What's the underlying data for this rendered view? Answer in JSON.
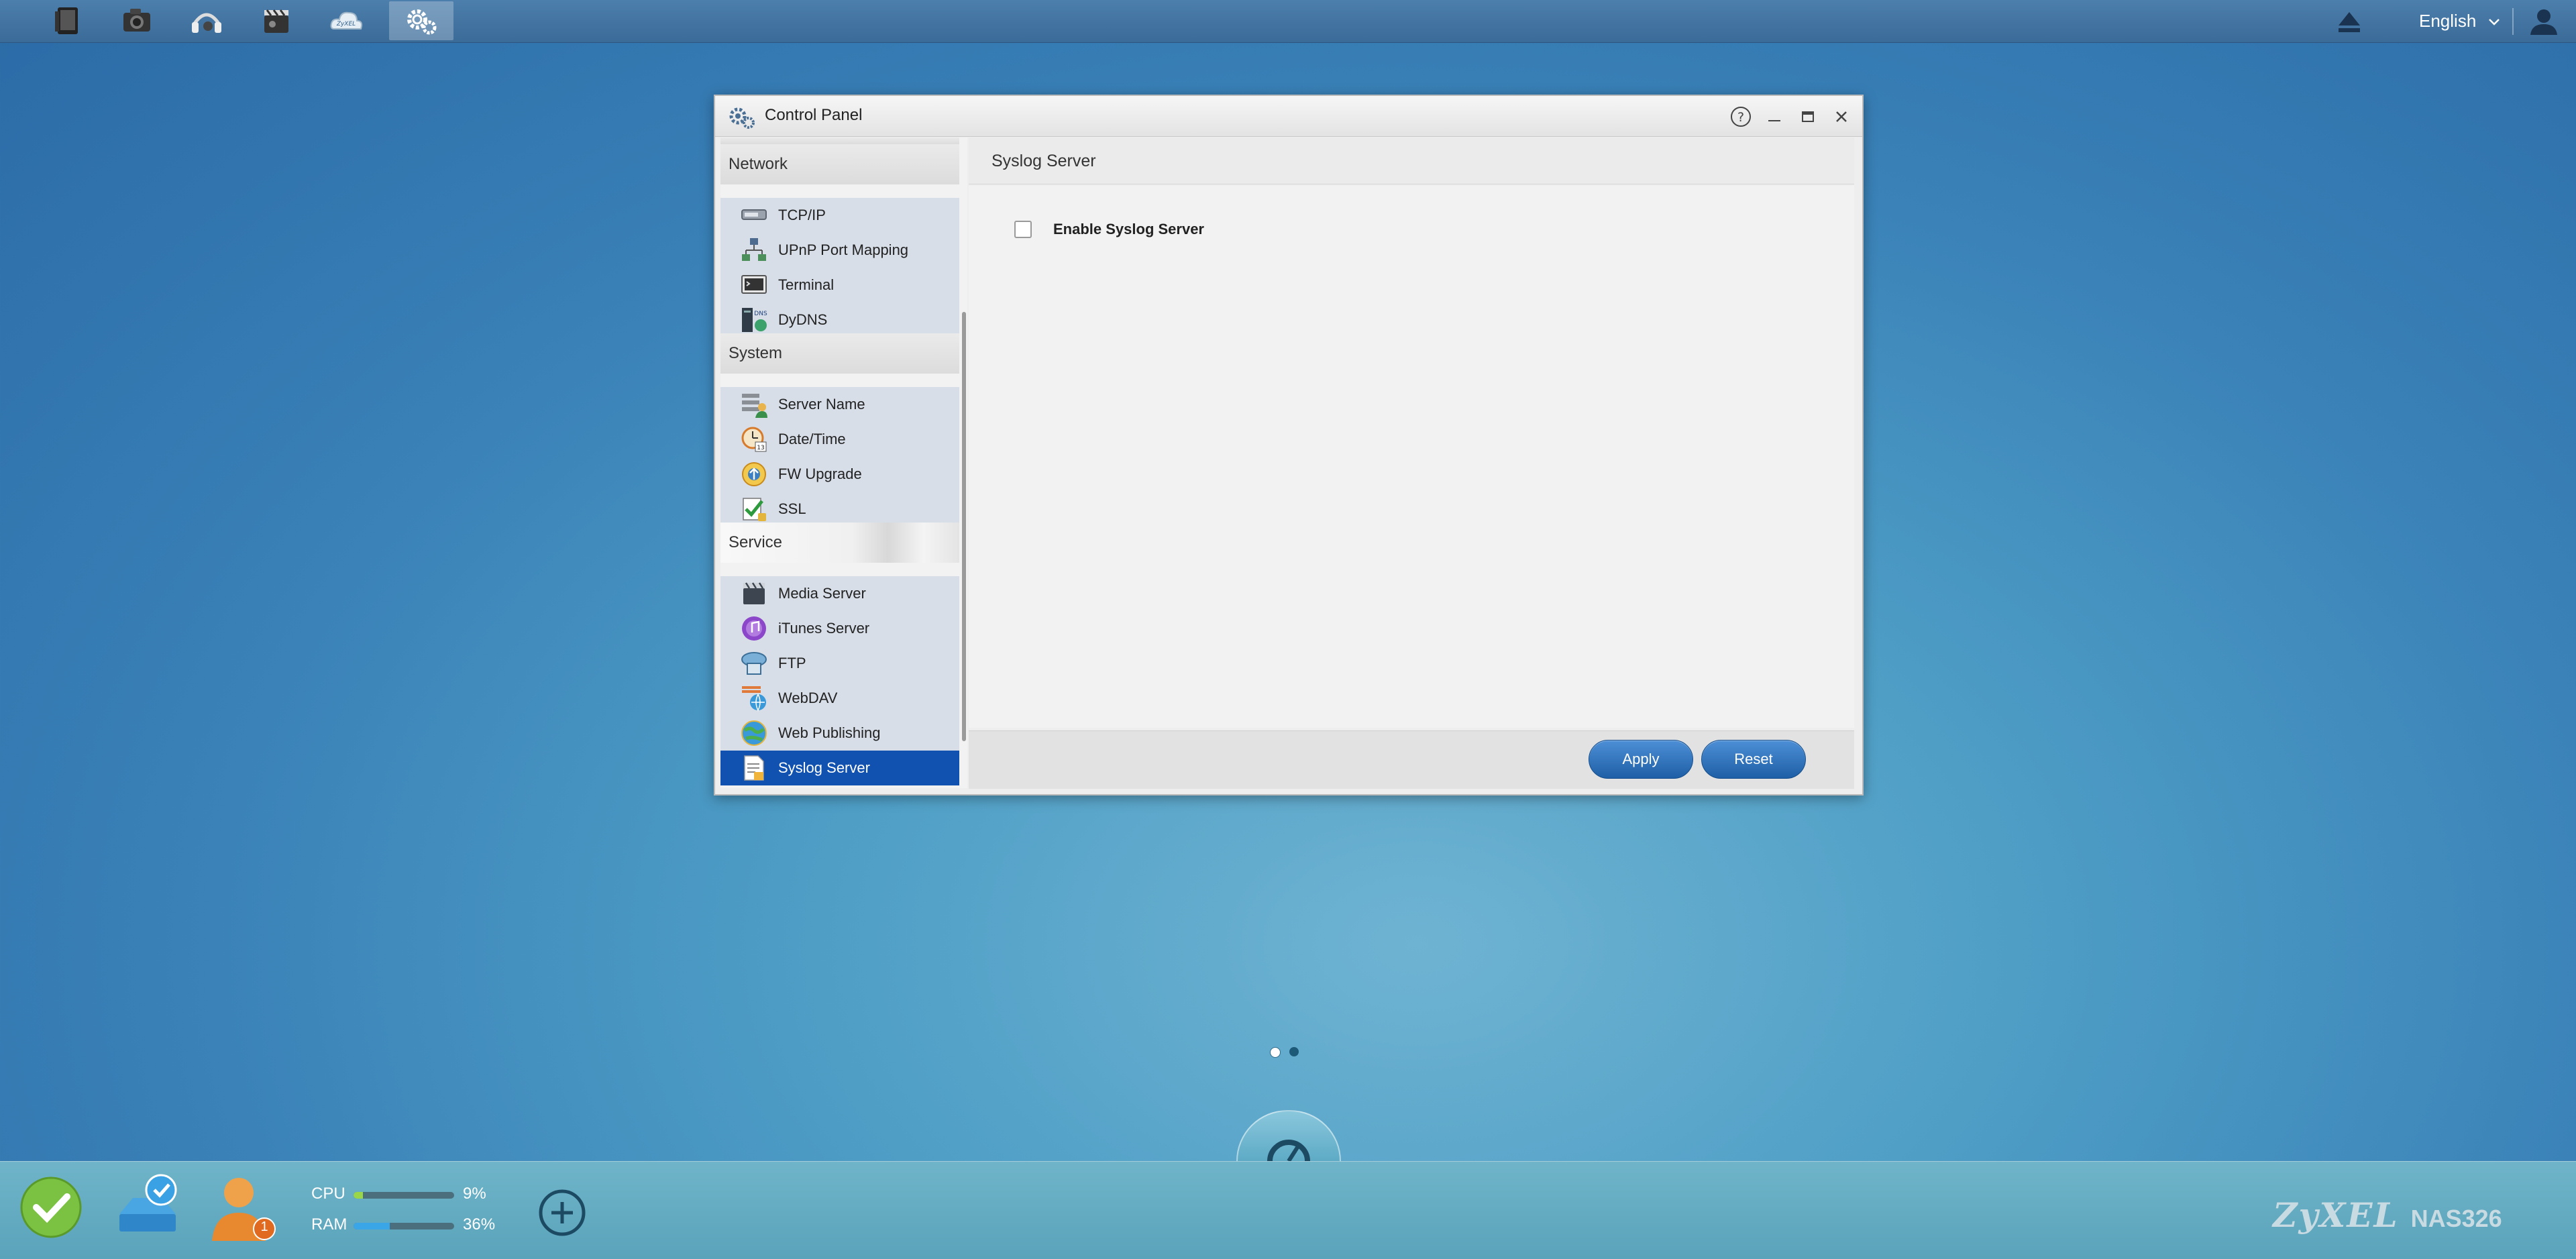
{
  "topbar": {
    "apps": [
      {
        "name": "file-browser-icon"
      },
      {
        "name": "photo-icon"
      },
      {
        "name": "music-icon"
      },
      {
        "name": "video-icon"
      },
      {
        "name": "zyxel-cloud-icon",
        "text": "ZyXEL"
      },
      {
        "name": "control-panel-gear-icon",
        "active": true
      }
    ],
    "language": "English"
  },
  "window": {
    "title": "Control Panel"
  },
  "sidebar": {
    "sections": [
      {
        "label": "Network",
        "items": [
          "TCP/IP",
          "UPnP Port Mapping",
          "Terminal",
          "DyDNS"
        ]
      },
      {
        "label": "System",
        "items": [
          "Server Name",
          "Date/Time",
          "FW Upgrade",
          "SSL"
        ]
      },
      {
        "label": "Service",
        "items": [
          "Media Server",
          "iTunes Server",
          "FTP",
          "WebDAV",
          "Web Publishing",
          "Syslog Server"
        ]
      }
    ],
    "selected": "Syslog Server",
    "dydns_badge": "DNS",
    "date_badge": "13"
  },
  "main": {
    "header": "Syslog Server",
    "enable_label": "Enable Syslog Server",
    "enable_checked": false,
    "apply_label": "Apply",
    "reset_label": "Reset"
  },
  "dock": {
    "user_badge": "1",
    "cpu_label": "CPU",
    "cpu_value": "9%",
    "cpu_fraction": 0.09,
    "ram_label": "RAM",
    "ram_value": "36%",
    "ram_fraction": 0.36,
    "brand": "ZyXEL",
    "model": "NAS326"
  },
  "colors": {
    "accent_blue": "#1152b0",
    "cpu_fill": "#9ad64a",
    "ram_fill": "#3aa6e8"
  }
}
